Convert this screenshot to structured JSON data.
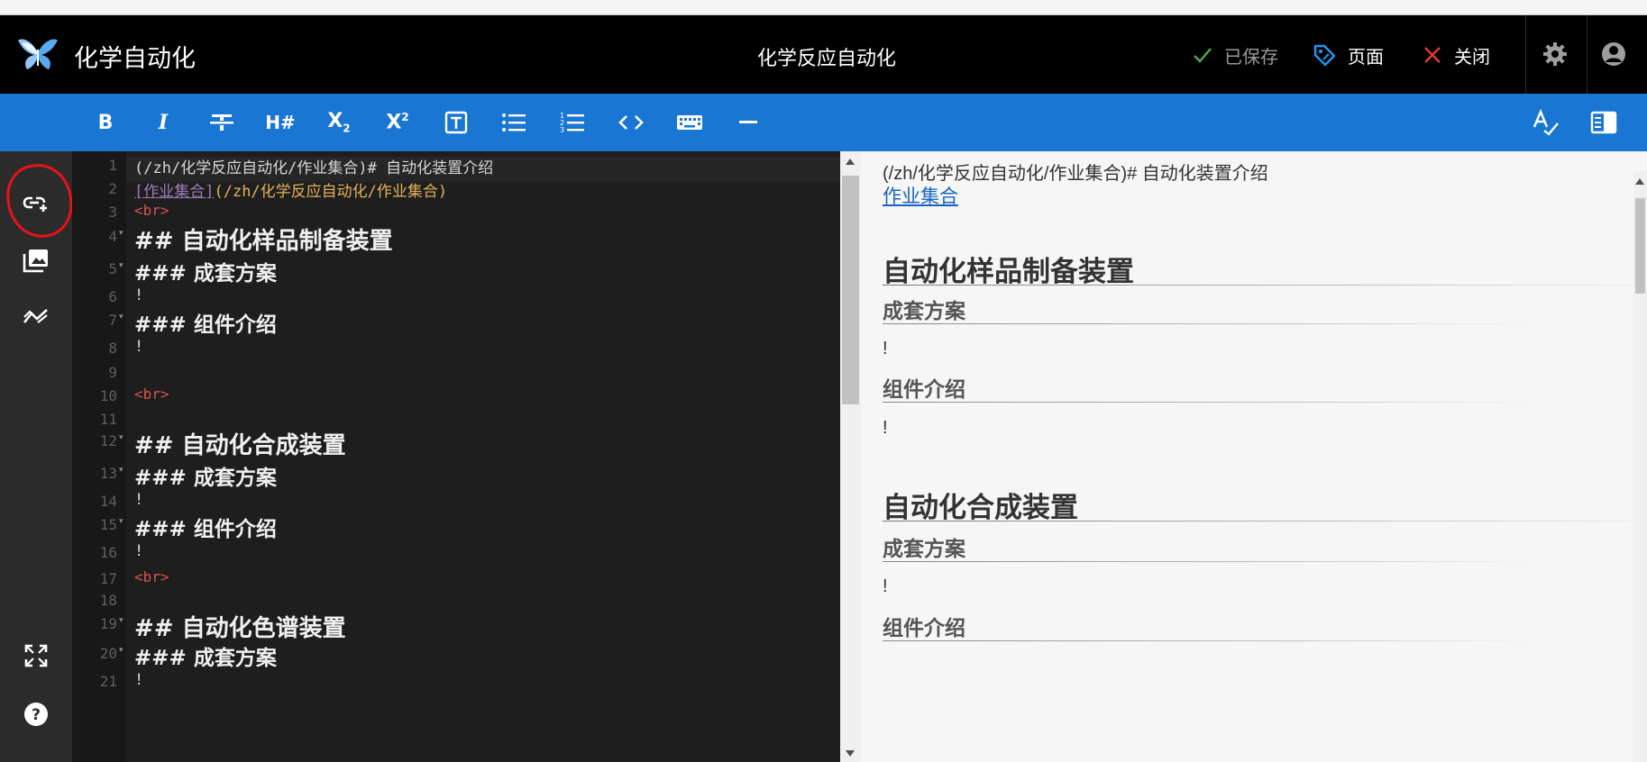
{
  "app": {
    "title": "化学自动化",
    "page_title": "化学反应自动化"
  },
  "header": {
    "saved_label": "已保存",
    "page_label": "页面",
    "close_label": "关闭"
  },
  "colors": {
    "header_bg": "#000000",
    "toolbar_bg": "#1976d2",
    "rail_bg": "#2b2b2b",
    "editor_bg": "#1e1e1e",
    "preview_bg": "#f6f6f6",
    "saved_check": "#4caf50",
    "page_icon": "#2196f3",
    "close_icon": "#e53935",
    "annotation": "#e8121b",
    "link": "#1565c0"
  },
  "toolbar": {
    "buttons": [
      {
        "name": "bold",
        "glyph": "B",
        "icon": "bold-icon"
      },
      {
        "name": "italic",
        "glyph": "I",
        "icon": "italic-icon"
      },
      {
        "name": "strikethrough",
        "glyph": "S",
        "icon": "strikethrough-icon"
      },
      {
        "name": "heading",
        "glyph": "H#",
        "icon": "heading-icon"
      },
      {
        "name": "subscript",
        "glyph": "X₂",
        "icon": "subscript-icon"
      },
      {
        "name": "superscript",
        "glyph": "X²",
        "icon": "superscript-icon"
      },
      {
        "name": "textbox",
        "glyph": "T",
        "icon": "textbox-icon"
      },
      {
        "name": "bullet-list",
        "icon": "bullet-list-icon"
      },
      {
        "name": "numbered-list",
        "icon": "numbered-list-icon"
      },
      {
        "name": "inline-code",
        "glyph": "<>",
        "icon": "code-icon"
      },
      {
        "name": "keyboard",
        "icon": "keyboard-icon"
      },
      {
        "name": "horizontal-rule",
        "icon": "horizontal-rule-icon"
      }
    ],
    "right": [
      {
        "name": "spellcheck",
        "icon": "spellcheck-icon"
      },
      {
        "name": "toggle-preview",
        "icon": "split-view-icon"
      }
    ]
  },
  "rail": {
    "top": [
      "insert-link-icon",
      "insert-image-icon",
      "insert-diagram-icon"
    ],
    "bottom": [
      "fullscreen-icon",
      "help-icon"
    ]
  },
  "editor": {
    "lines": [
      {
        "n": "1",
        "fold": false,
        "kind": "plain",
        "text": "(/zh/化学反应自动化/作业集合)# 自动化装置介绍"
      },
      {
        "n": "2",
        "fold": false,
        "kind": "link",
        "link_text": "[作业集合]",
        "link_url": "(/zh/化学反应自动化/作业集合)"
      },
      {
        "n": "3",
        "fold": false,
        "kind": "tag",
        "text": "<br>"
      },
      {
        "n": "4",
        "fold": true,
        "kind": "h2",
        "text": "## 自动化样品制备装置"
      },
      {
        "n": "5",
        "fold": true,
        "kind": "h3",
        "text": "### 成套方案"
      },
      {
        "n": "6",
        "fold": false,
        "kind": "plain",
        "text": "!"
      },
      {
        "n": "7",
        "fold": true,
        "kind": "h3",
        "text": "### 组件介绍"
      },
      {
        "n": "8",
        "fold": false,
        "kind": "plain",
        "text": "!"
      },
      {
        "n": "9",
        "fold": false,
        "kind": "plain",
        "text": ""
      },
      {
        "n": "10",
        "fold": false,
        "kind": "tag",
        "text": "<br>"
      },
      {
        "n": "11",
        "fold": false,
        "kind": "plain",
        "text": ""
      },
      {
        "n": "12",
        "fold": true,
        "kind": "h2",
        "text": "## 自动化合成装置"
      },
      {
        "n": "13",
        "fold": true,
        "kind": "h3",
        "text": "### 成套方案"
      },
      {
        "n": "14",
        "fold": false,
        "kind": "plain",
        "text": "!"
      },
      {
        "n": "15",
        "fold": true,
        "kind": "h3",
        "text": "### 组件介绍"
      },
      {
        "n": "16",
        "fold": false,
        "kind": "plain",
        "text": "!"
      },
      {
        "n": "17",
        "fold": false,
        "kind": "tag",
        "text": "<br>"
      },
      {
        "n": "18",
        "fold": false,
        "kind": "plain",
        "text": ""
      },
      {
        "n": "19",
        "fold": true,
        "kind": "h2",
        "text": "## 自动化色谱装置"
      },
      {
        "n": "20",
        "fold": true,
        "kind": "h3",
        "text": "### 成套方案"
      },
      {
        "n": "21",
        "fold": false,
        "kind": "plain",
        "text": "!"
      }
    ]
  },
  "preview": {
    "blocks": [
      {
        "kind": "plain",
        "text": "(/zh/化学反应自动化/作业集合)# 自动化装置介绍"
      },
      {
        "kind": "link",
        "text": "作业集合"
      },
      {
        "kind": "h2",
        "text": "自动化样品制备装置"
      },
      {
        "kind": "h3",
        "text": "成套方案"
      },
      {
        "kind": "plain",
        "text": "!"
      },
      {
        "kind": "h3",
        "text": "组件介绍"
      },
      {
        "kind": "plain",
        "text": "!"
      },
      {
        "kind": "h2",
        "text": "自动化合成装置"
      },
      {
        "kind": "h3",
        "text": "成套方案"
      },
      {
        "kind": "plain",
        "text": "!"
      },
      {
        "kind": "h3",
        "text": "组件介绍"
      }
    ]
  }
}
